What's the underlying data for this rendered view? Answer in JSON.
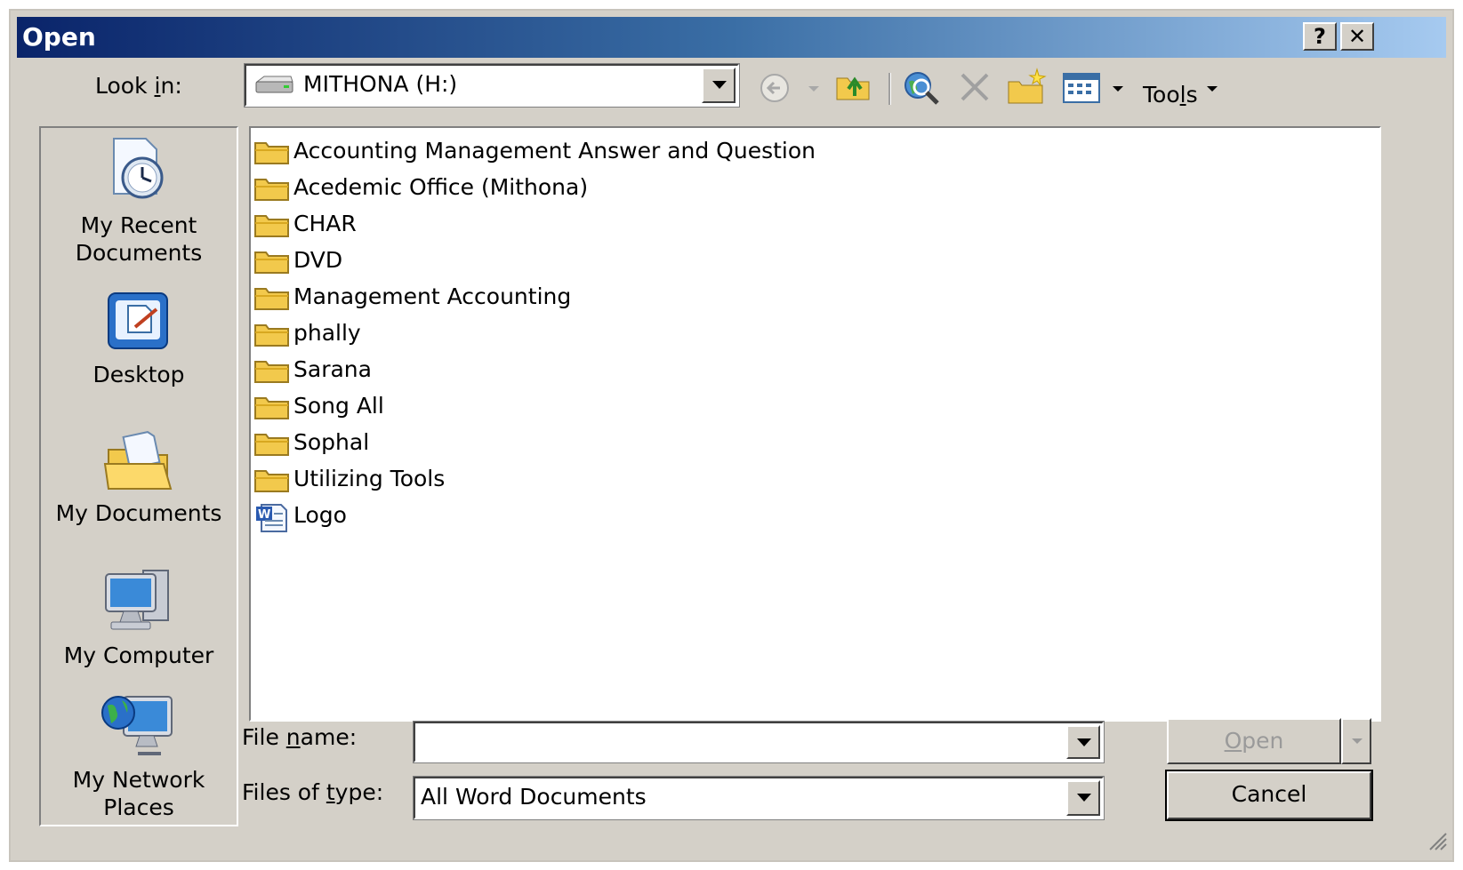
{
  "window": {
    "title": "Open",
    "help_button": "?",
    "close_button": "✕"
  },
  "lookin": {
    "label_pre": "Look ",
    "label_accel": "i",
    "label_post": "n:",
    "value": "MITHONA (H:)"
  },
  "toolbar": {
    "tools_pre": "Too",
    "tools_accel": "l",
    "tools_post": "s"
  },
  "places": [
    {
      "line1": "My Recent",
      "line2": "Documents",
      "icon": "recent-documents-icon"
    },
    {
      "line1": "Desktop",
      "line2": "",
      "icon": "desktop-icon"
    },
    {
      "line1": "My Documents",
      "line2": "",
      "icon": "my-documents-icon"
    },
    {
      "line1": "My Computer",
      "line2": "",
      "icon": "my-computer-icon"
    },
    {
      "line1": "My Network",
      "line2": "Places",
      "icon": "network-places-icon"
    }
  ],
  "files": [
    {
      "name": "Accounting Management Answer and Question",
      "type": "folder"
    },
    {
      "name": "Acedemic Office (Mithona)",
      "type": "folder"
    },
    {
      "name": "CHAR",
      "type": "folder"
    },
    {
      "name": "DVD",
      "type": "folder"
    },
    {
      "name": "Management Accounting",
      "type": "folder"
    },
    {
      "name": "phally",
      "type": "folder"
    },
    {
      "name": "Sarana",
      "type": "folder"
    },
    {
      "name": "Song All",
      "type": "folder"
    },
    {
      "name": "Sophal",
      "type": "folder"
    },
    {
      "name": "Utilizing Tools",
      "type": "folder"
    },
    {
      "name": "Logo",
      "type": "word-document"
    }
  ],
  "filename": {
    "label_pre": "File ",
    "label_accel": "n",
    "label_post": "ame:",
    "value": ""
  },
  "filetype": {
    "label_pre": "Files of ",
    "label_accel": "t",
    "label_post": "ype:",
    "value": "All Word Documents"
  },
  "buttons": {
    "open_accel": "O",
    "open_rest": "pen",
    "cancel": "Cancel"
  },
  "colors": {
    "title_start": "#0a246a",
    "title_end": "#a6caf0",
    "face": "#d4d0c8",
    "folder": "#f2c94c"
  }
}
